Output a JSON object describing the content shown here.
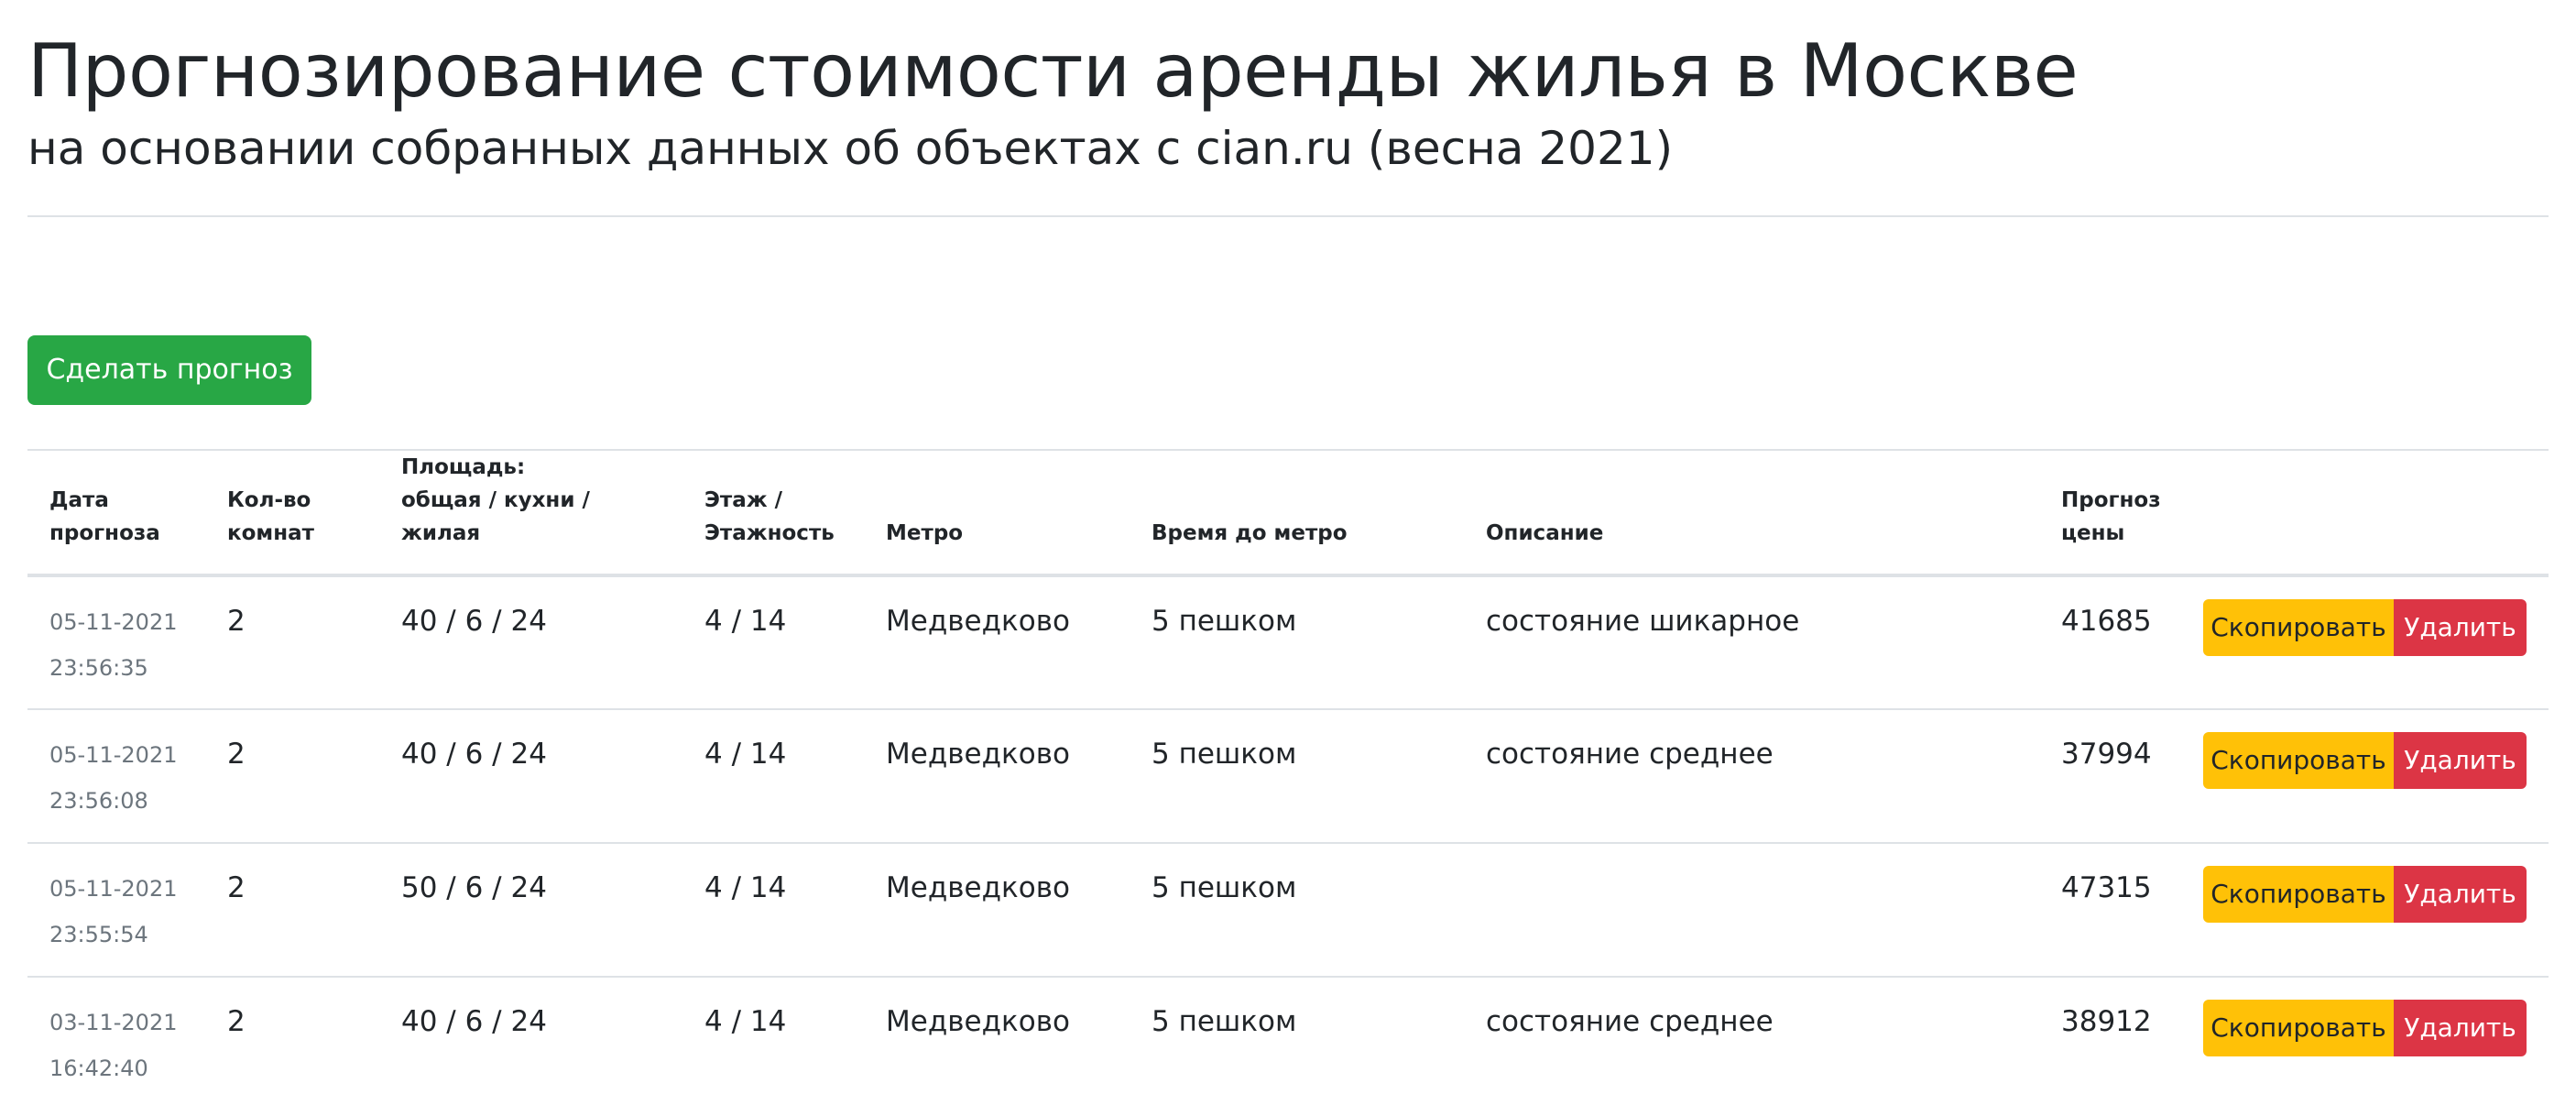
{
  "header": {
    "title": "Прогнозирование стоимости аренды жилья в Москве",
    "subtitle": "на основании собранных данных об объектах с cian.ru (весна 2021)"
  },
  "actions": {
    "predict_label": "Сделать прогноз"
  },
  "table": {
    "columns": {
      "date": "Дата прогноза",
      "rooms": "Кол-во комнат",
      "area_line1": "Площадь:",
      "area_line2": "общая / кухни / жилая",
      "floor": "Этаж / Этажность",
      "metro": "Метро",
      "metro_time": "Время до метро",
      "description": "Описание",
      "price": "Прогноз цены"
    },
    "rows": [
      {
        "date": "05-11-2021 23:56:35",
        "rooms": "2",
        "area": "40 / 6 / 24",
        "floor": "4 / 14",
        "metro": "Медведково",
        "metro_time": "5 пешком",
        "description": "состояние шикарное",
        "price": "41685",
        "copy_label": "Скопировать",
        "delete_label": "Удалить"
      },
      {
        "date": "05-11-2021 23:56:08",
        "rooms": "2",
        "area": "40 / 6 / 24",
        "floor": "4 / 14",
        "metro": "Медведково",
        "metro_time": "5 пешком",
        "description": "состояние среднее",
        "price": "37994",
        "copy_label": "Скопировать",
        "delete_label": "Удалить"
      },
      {
        "date": "05-11-2021 23:55:54",
        "rooms": "2",
        "area": "50 / 6 / 24",
        "floor": "4 / 14",
        "metro": "Медведково",
        "metro_time": "5 пешком",
        "description": "",
        "price": "47315",
        "copy_label": "Скопировать",
        "delete_label": "Удалить"
      },
      {
        "date": "03-11-2021 16:42:40",
        "rooms": "2",
        "area": "40 / 6 / 24",
        "floor": "4 / 14",
        "metro": "Медведково",
        "metro_time": "5 пешком",
        "description": "состояние среднее",
        "price": "38912",
        "copy_label": "Скопировать",
        "delete_label": "Удалить"
      }
    ]
  },
  "colors": {
    "success": "#28a745",
    "warning": "#ffc107",
    "danger": "#dc3545",
    "muted": "#6c757d",
    "border": "#dee2e6",
    "text": "#212529"
  }
}
